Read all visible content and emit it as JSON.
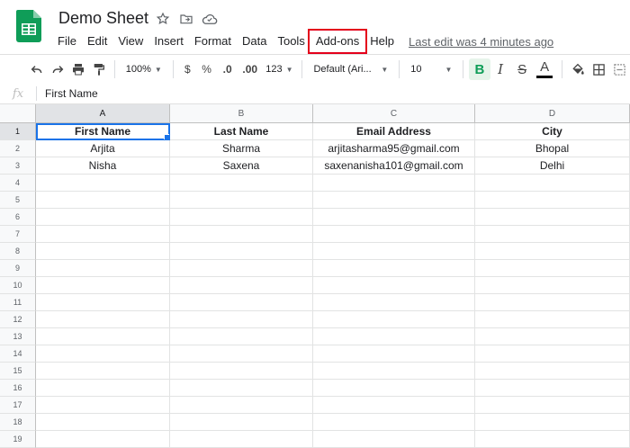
{
  "doc": {
    "title": "Demo Sheet"
  },
  "menu": {
    "items": [
      "File",
      "Edit",
      "View",
      "Insert",
      "Format",
      "Data",
      "Tools",
      "Add-ons",
      "Help"
    ],
    "highlighted": "Add-ons",
    "last_edit": "Last edit was 4 minutes ago"
  },
  "toolbar": {
    "zoom": "100%",
    "currency": "$",
    "percent": "%",
    "dec_decrease": ".0",
    "dec_increase": ".00",
    "more_formats": "123",
    "font": "Default (Ari...",
    "font_size": "10",
    "bold": "B",
    "italic": "I",
    "strike": "S",
    "text_color_letter": "A"
  },
  "formula_bar": {
    "fx": "fx",
    "value": "First Name"
  },
  "sheet": {
    "columns": [
      "A",
      "B",
      "C",
      "D"
    ],
    "rows": [
      [
        "First Name",
        "Last Name",
        "Email Address",
        "City"
      ],
      [
        "Arjita",
        "Sharma",
        "arjitasharma95@gmail.com",
        "Bhopal"
      ],
      [
        "Nisha",
        "Saxena",
        "saxenanisha101@gmail.com",
        "Delhi"
      ],
      [
        "",
        "",
        "",
        ""
      ],
      [
        "",
        "",
        "",
        ""
      ],
      [
        "",
        "",
        "",
        ""
      ],
      [
        "",
        "",
        "",
        ""
      ],
      [
        "",
        "",
        "",
        ""
      ],
      [
        "",
        "",
        "",
        ""
      ],
      [
        "",
        "",
        "",
        ""
      ],
      [
        "",
        "",
        "",
        ""
      ],
      [
        "",
        "",
        "",
        ""
      ],
      [
        "",
        "",
        "",
        ""
      ],
      [
        "",
        "",
        "",
        ""
      ],
      [
        "",
        "",
        "",
        ""
      ],
      [
        "",
        "",
        "",
        ""
      ],
      [
        "",
        "",
        "",
        ""
      ],
      [
        "",
        "",
        "",
        ""
      ],
      [
        "",
        "",
        "",
        ""
      ]
    ],
    "row_numbers": [
      "1",
      "2",
      "3",
      "4",
      "5",
      "6",
      "7",
      "8",
      "9",
      "10",
      "11",
      "12",
      "13",
      "14",
      "15",
      "16",
      "17",
      "18",
      "19"
    ],
    "active_cell": "A1"
  },
  "colors": {
    "accent": "#1a73e8",
    "highlight_box": "#e4001b",
    "sheets_green": "#0f9d58"
  }
}
